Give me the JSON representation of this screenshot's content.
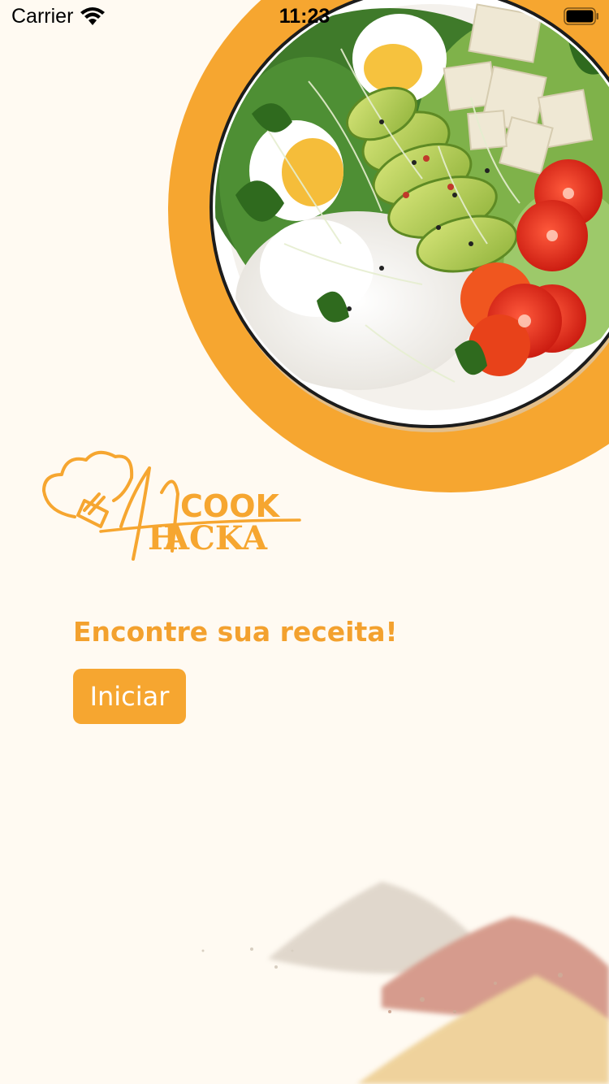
{
  "status_bar": {
    "carrier": "Carrier",
    "time": "11:23",
    "wifi_icon": "wifi-icon",
    "battery_icon": "battery-icon"
  },
  "hero": {
    "image": "salad-bowl-image"
  },
  "logo": {
    "word_top": "COOK",
    "word_bottom": "ACKA",
    "letter_h": "H",
    "icon": "chef-hat-icon"
  },
  "main": {
    "tagline": "Encontre sua receita!",
    "start_button_label": "Iniciar"
  },
  "decor": {
    "image": "spices-image"
  },
  "colors": {
    "accent": "#f6a630",
    "background": "#fffaf2",
    "button_text": "#ffffff"
  }
}
